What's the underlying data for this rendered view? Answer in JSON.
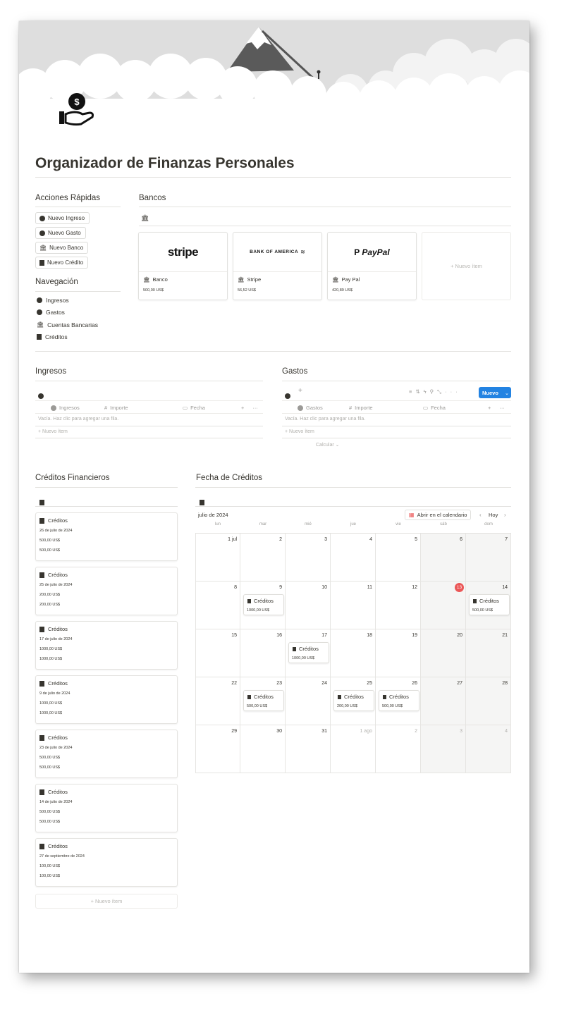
{
  "page": {
    "title": "Organizador de Finanzas Personales",
    "icon": "hand-holding-dollar-icon"
  },
  "quick_actions": {
    "heading": "Acciones Rápidas",
    "buttons": [
      {
        "label": "Nuevo Ingreso",
        "icon": "arrow-up-circle-icon"
      },
      {
        "label": "Nuevo Gasto",
        "icon": "arrow-down-circle-icon"
      },
      {
        "label": "Nuevo Banco",
        "icon": "bank-icon"
      },
      {
        "label": "Nuevo Crédito",
        "icon": "credit-doc-icon"
      }
    ]
  },
  "navigation": {
    "heading": "Navegación",
    "items": [
      {
        "label": "Ingresos",
        "icon": "arrow-up-circle-icon"
      },
      {
        "label": "Gastos",
        "icon": "arrow-down-circle-icon"
      },
      {
        "label": "Cuentas Bancarias",
        "icon": "bank-icon"
      },
      {
        "label": "Créditos",
        "icon": "credit-doc-icon"
      }
    ]
  },
  "banks": {
    "heading": "Bancos",
    "cards": [
      {
        "logo": "stripe",
        "name": "Banco",
        "amount": "500,00 US$"
      },
      {
        "logo": "BANK OF AMERICA",
        "name": "Stripe",
        "amount": "56,52 US$"
      },
      {
        "logo": "PayPal",
        "name": "Pay Pal",
        "amount": "420,89 US$"
      }
    ],
    "new_item": "+ Nuevo ítem"
  },
  "ingresos": {
    "heading": "Ingresos",
    "columns": [
      "Ingresos",
      "Importe",
      "Fecha"
    ],
    "empty": "Vacía. Haz clic para agregar una fila.",
    "new_item": "+ Nuevo ítem"
  },
  "gastos": {
    "heading": "Gastos",
    "columns": [
      "Gastos",
      "Importe",
      "Fecha"
    ],
    "empty": "Vacía. Haz clic para agregar una fila.",
    "new_item": "+ Nuevo ítem",
    "calculate": "Calcular ⌄",
    "new_button": "Nuevo",
    "accent": "#2383e2"
  },
  "creditos": {
    "heading": "Créditos Financieros",
    "cards": [
      {
        "title": "Créditos",
        "date": "26 de julio de 2024",
        "a1": "500,00 US$",
        "a2": "500,00 US$"
      },
      {
        "title": "Créditos",
        "date": "25 de julio de 2024",
        "a1": "200,00 US$",
        "a2": "200,00 US$"
      },
      {
        "title": "Créditos",
        "date": "17 de julio de 2024",
        "a1": "1000,00 US$",
        "a2": "1000,00 US$"
      },
      {
        "title": "Créditos",
        "date": "9 de julio de 2024",
        "a1": "1000,00 US$",
        "a2": "1000,00 US$"
      },
      {
        "title": "Créditos",
        "date": "23 de julio de 2024",
        "a1": "500,00 US$",
        "a2": "500,00 US$"
      },
      {
        "title": "Créditos",
        "date": "14 de julio de 2024",
        "a1": "500,00 US$",
        "a2": "500,00 US$"
      },
      {
        "title": "Créditos",
        "date": "27 de septiembre de 2024",
        "a1": "100,00 US$",
        "a2": "100,00 US$"
      }
    ],
    "new_item": "+ Nuevo ítem"
  },
  "calendar": {
    "heading": "Fecha de Créditos",
    "month": "julio de 2024",
    "open_button": "Abrir en el calendario",
    "today_button": "Hoy",
    "today_color": "#eb5757",
    "weekdays": [
      "lun",
      "mar",
      "mié",
      "jue",
      "vie",
      "sáb",
      "dom"
    ],
    "weeks": [
      [
        "1 jul",
        "2",
        "3",
        "4",
        "5",
        "6",
        "7"
      ],
      [
        "8",
        "9",
        "10",
        "11",
        "12",
        "13",
        "14"
      ],
      [
        "15",
        "16",
        "17",
        "18",
        "19",
        "20",
        "21"
      ],
      [
        "22",
        "23",
        "24",
        "25",
        "26",
        "27",
        "28"
      ],
      [
        "29",
        "30",
        "31",
        "1 ago",
        "2",
        "3",
        "4"
      ]
    ],
    "events": [
      {
        "week": 1,
        "day": 1,
        "title": "Créditos",
        "amount": "1000,00 US$"
      },
      {
        "week": 1,
        "day": 6,
        "title": "Créditos",
        "amount": "500,00 US$"
      },
      {
        "week": 2,
        "day": 2,
        "title": "Créditos",
        "amount": "1000,00 US$"
      },
      {
        "week": 3,
        "day": 1,
        "title": "Créditos",
        "amount": "500,00 US$"
      },
      {
        "week": 3,
        "day": 3,
        "title": "Créditos",
        "amount": "200,00 US$"
      },
      {
        "week": 3,
        "day": 4,
        "title": "Créditos",
        "amount": "500,00 US$"
      }
    ]
  }
}
